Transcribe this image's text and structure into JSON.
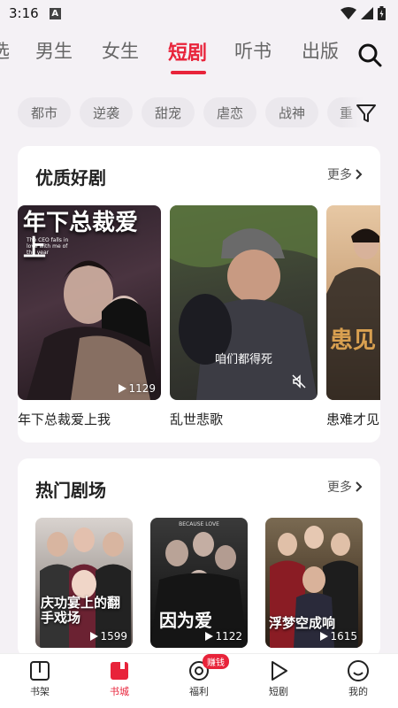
{
  "status": {
    "time": "3:16",
    "notification_letter": "A"
  },
  "top_tabs": [
    "选",
    "男生",
    "女生",
    "短剧",
    "听书",
    "出版"
  ],
  "active_tab_index": 3,
  "genres": [
    "都市",
    "逆袭",
    "甜宠",
    "虐恋",
    "战神",
    "重"
  ],
  "section1": {
    "title": "优质好剧",
    "more": "更多",
    "items": [
      {
        "title": "年下总裁爱上我",
        "plays": "1129",
        "poster_text_big": "年下总裁爱上",
        "poster_text_small": "The CEO falls in love with me of the year"
      },
      {
        "title": "乱世悲歌",
        "plays": "",
        "subtitle": "咱们都得死"
      },
      {
        "title": "患难才见",
        "plays": "",
        "poster_text_big": "患见"
      }
    ]
  },
  "section2": {
    "title": "热门剧场",
    "more": "更多",
    "items": [
      {
        "plays": "1599",
        "poster_text": "庆功宴上的翻手戏场"
      },
      {
        "plays": "1122",
        "poster_text": "因为爱",
        "poster_text_en": "BECAUSE LOVE"
      },
      {
        "plays": "1615",
        "poster_text": "浮梦空成响"
      }
    ]
  },
  "bottom_nav": [
    {
      "label": "书架",
      "icon": "book-icon"
    },
    {
      "label": "书城",
      "icon": "bookstore-icon"
    },
    {
      "label": "福利",
      "icon": "welfare-icon",
      "badge": "赚钱"
    },
    {
      "label": "短剧",
      "icon": "play-icon"
    },
    {
      "label": "我的",
      "icon": "smile-icon"
    }
  ],
  "colors": {
    "accent": "#e8233a"
  }
}
